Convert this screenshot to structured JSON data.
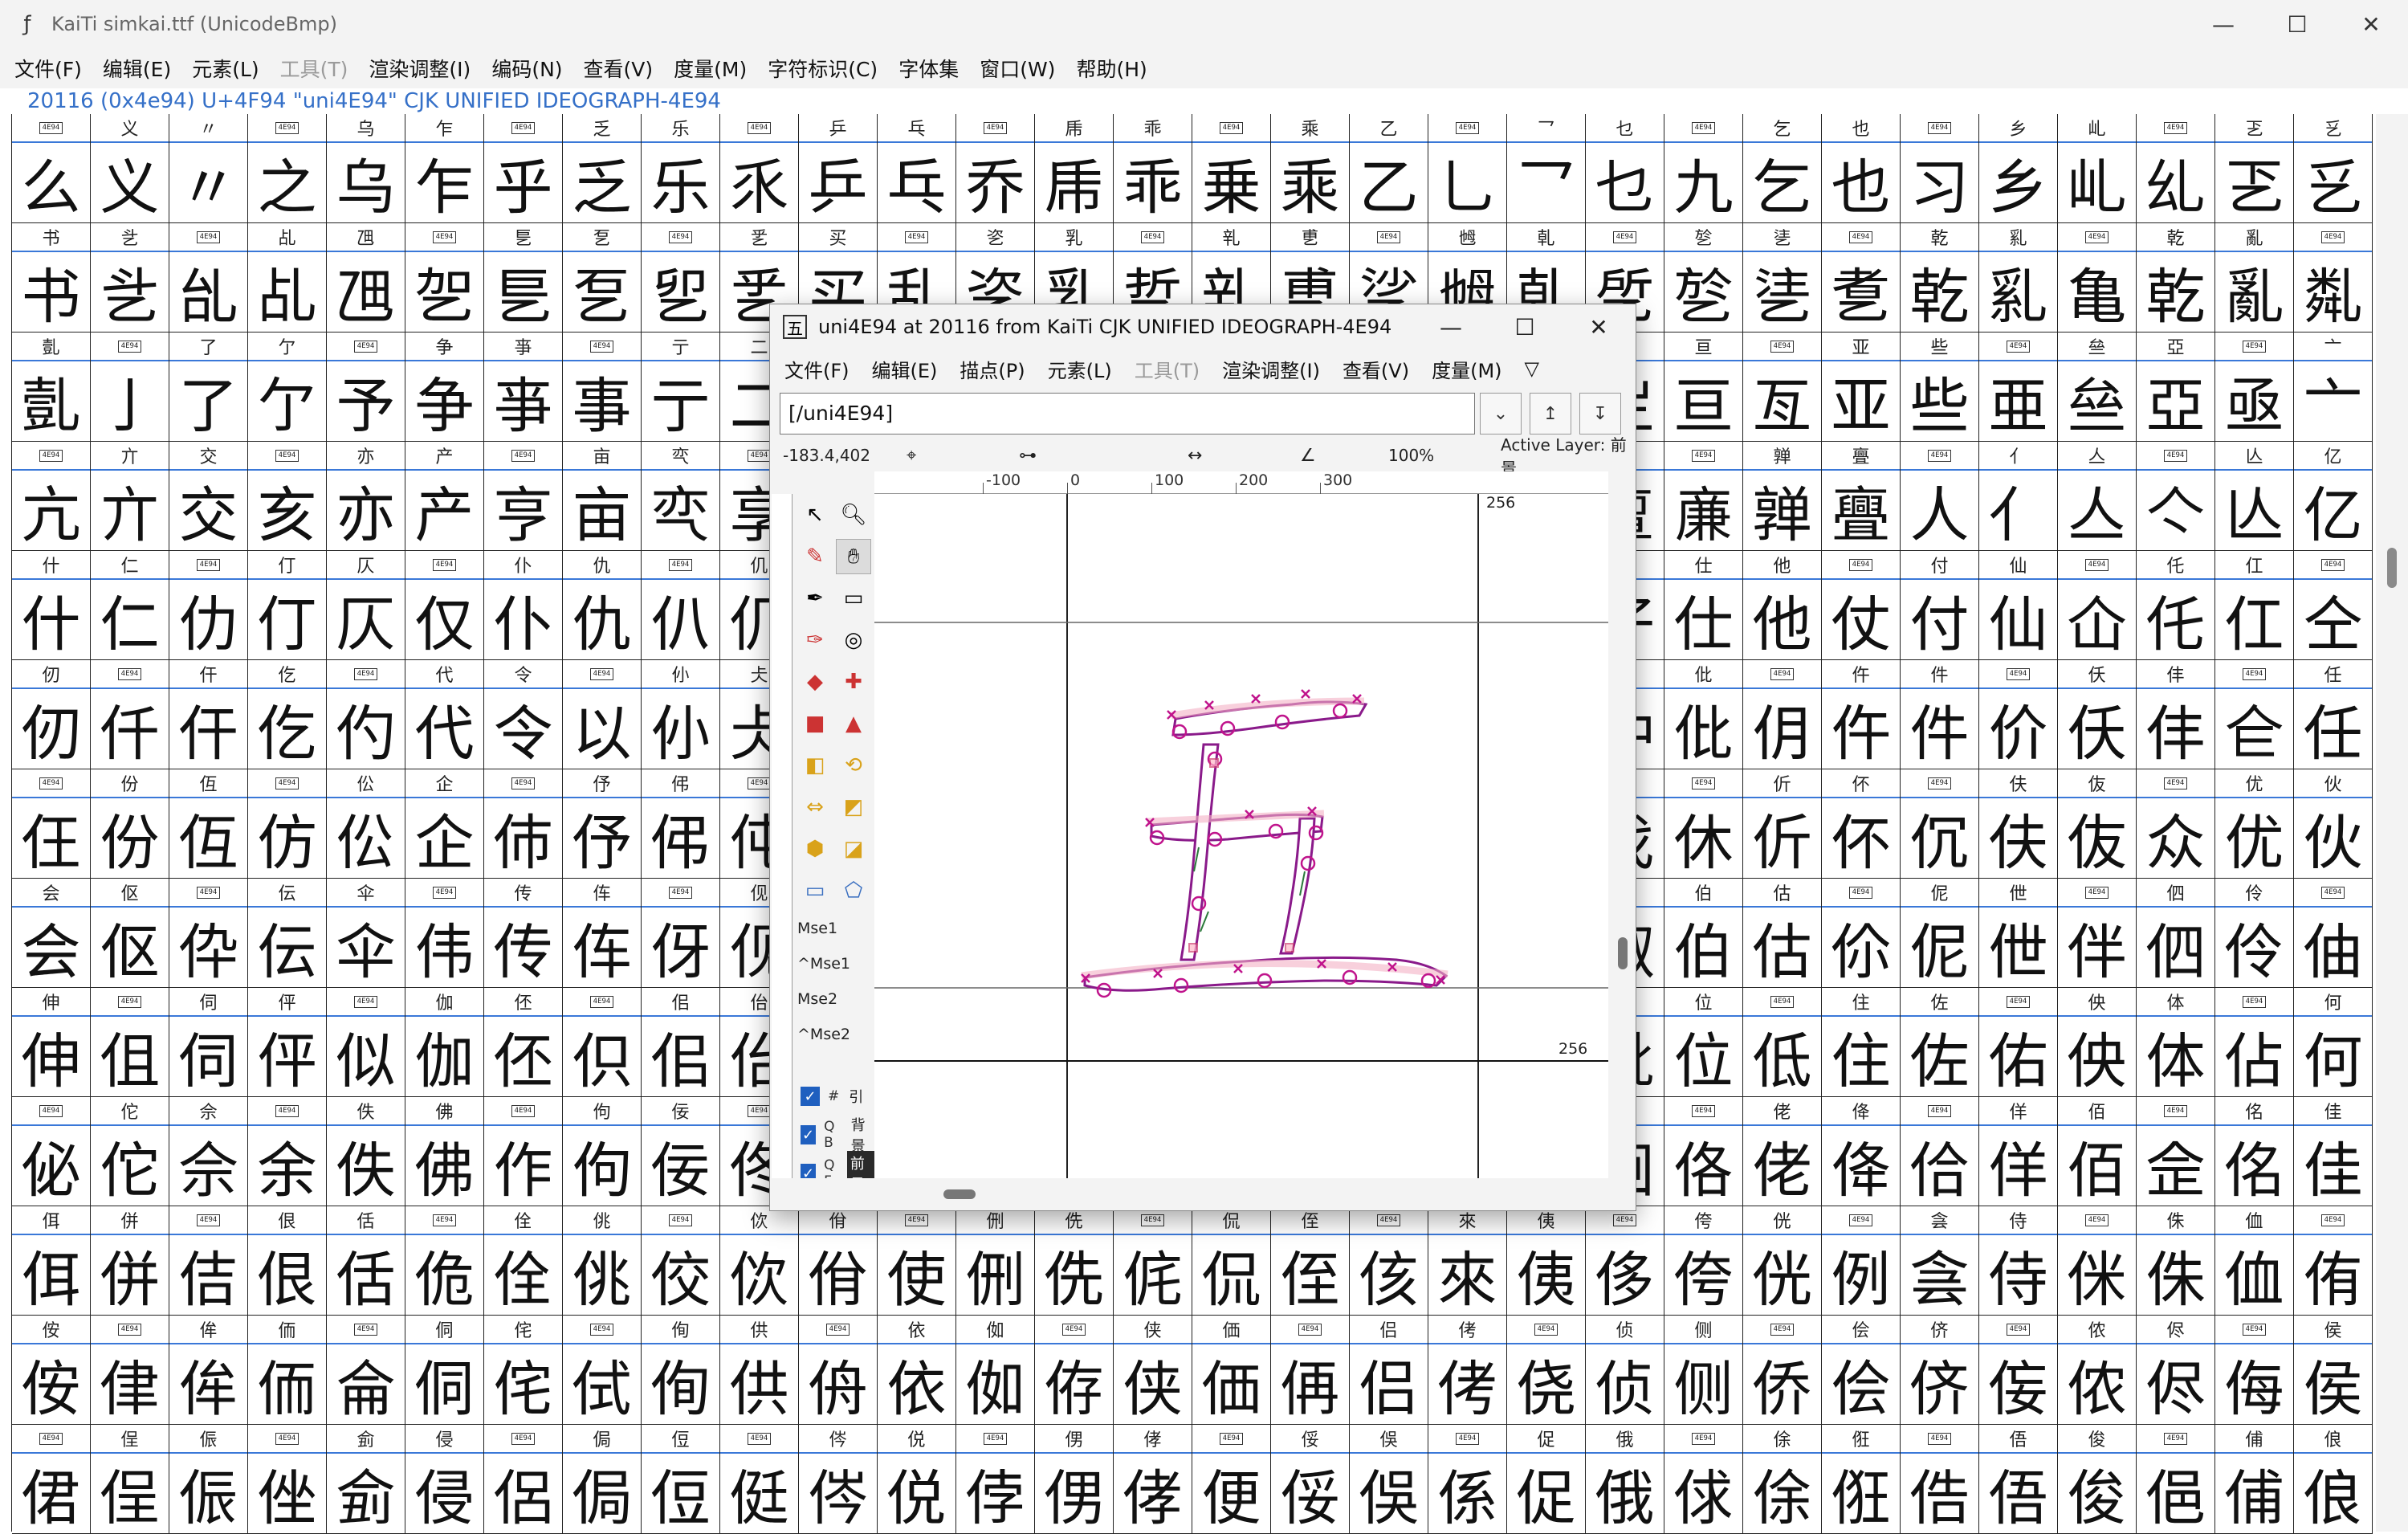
{
  "window": {
    "title": "KaiTi  simkai.ttf (UnicodeBmp)",
    "minimize": "—",
    "maximize": "☐",
    "close": "✕"
  },
  "menu": [
    {
      "label": "文件(F)",
      "disabled": false
    },
    {
      "label": "编辑(E)",
      "disabled": false
    },
    {
      "label": "元素(L)",
      "disabled": false
    },
    {
      "label": "工具(T)",
      "disabled": true
    },
    {
      "label": "渲染调整(I)",
      "disabled": false
    },
    {
      "label": "编码(N)",
      "disabled": false
    },
    {
      "label": "查看(V)",
      "disabled": false
    },
    {
      "label": "度量(M)",
      "disabled": false
    },
    {
      "label": "字符标识(C)",
      "disabled": false
    },
    {
      "label": "字体集",
      "disabled": false
    },
    {
      "label": "窗口(W)",
      "disabled": false
    },
    {
      "label": "帮助(H)",
      "disabled": false
    }
  ],
  "info_line": "20116 (0x4e94) U+4F94 \"uni4E94\" CJK UNIFIED IDEOGRAPH-4E94",
  "grid": {
    "columns": 30,
    "rows": [
      "么义〃之乌乍乎乏乐乑乒乓乔乕乖乗乘乙乚乛乜九乞也习乡乢乣乤乥",
      "书乧乨乩乪乫乬乭乮乯买乱乲乳乴乵乶乷乸乹乺乻乼乽乾乿亀乾亂亃",
      "亄亅了亇予争亊事亍二亍于亏亐云互亓五井亖亗亘亙亚些亜亝亞亟亠亡",
      "亢亣交亥亦产亨亩亪享京亭亮亯亰亱亲亳亴亵亶亷亸亹人亻亼亽亾亿",
      "什仁仂仃仄仅仆仇仈仉今介仌仍从仏仐仑仒仓仔仕他仗付仙仚仛仜仝",
      "仞仟仠仡仢代令以仦仧仨仩仪仫们仭仮仯仰仱仲仳仴仵件价仸仹仺任",
      "仼份仾仿伀企伂伃伄伅伆伇伈伉伊伋伌伍伎伏伐休伒伓伔伕伖众优伙",
      "会伛伜伝伞伟传伡伢伣伤伥伦伧伨伩伪伫伬伭伮伯估伱伲伳伴伵伶伷",
      "伸伹伺伻似伽伾伿佀佁佂佃佄佅但佇佈佉佊佋佌位低住佐佑佒体佔何",
      "佖佗佘余佚佛作佝佞佟你佡佢佣佤佥佦佧佨佩佪佫佬佭佮佯佰佱佲佳",
      "佴併佶佷佸佹佺佻佼佽佾使侀侁侂侃侄侅來侇侈侉侊例侌侍侎侏侐侑",
      "侒侓侔侕侖侗侘侙侚供侜依侞侟侠価侢侣侤侥侦侧侨侩侪侫侬侭侮侯",
      "侰侱侲侳侴侵侶侷侸侹侺侻侼侽侾便俀俁係促俄俅俆俇俈俉俊俋俌俍"
    ],
    "hex_labels": "4E94"
  },
  "editor": {
    "title": "uni4E94 at 20116 from KaiTi CJK UNIFIED IDEOGRAPH-4E94",
    "icon_char": "五",
    "menu": [
      {
        "label": "文件(F)",
        "disabled": false
      },
      {
        "label": "编辑(E)",
        "disabled": false
      },
      {
        "label": "描点(P)",
        "disabled": false
      },
      {
        "label": "元素(L)",
        "disabled": false
      },
      {
        "label": "工具(T)",
        "disabled": true
      },
      {
        "label": "渲染调整(I)",
        "disabled": false
      },
      {
        "label": "查看(V)",
        "disabled": false
      },
      {
        "label": "度量(M)",
        "disabled": false
      }
    ],
    "more_menu": "▽",
    "glyph_name": "[/uni4E94]",
    "coords": "-183.4,402",
    "zoom": "100%",
    "active_layer": "Active Layer: 前景",
    "ruler_h": [
      {
        "label": "-100",
        "val": -100
      },
      {
        "label": "0",
        "val": 0
      },
      {
        "label": "100",
        "val": 100
      },
      {
        "label": "200",
        "val": 200
      },
      {
        "label": "300",
        "val": 300
      }
    ],
    "canvas_labels": {
      "top": "256",
      "right": "256"
    },
    "mouse": {
      "mse1": "Mse1",
      "cmse1": "^Mse1",
      "mse2": "Mse2",
      "cmse2": "^Mse2"
    },
    "layers": [
      {
        "key": "#",
        "name": "引",
        "active": false
      },
      {
        "key": "Q B",
        "name": "背景",
        "active": false
      },
      {
        "key": "Q F",
        "name": "前景",
        "active": true
      }
    ]
  }
}
